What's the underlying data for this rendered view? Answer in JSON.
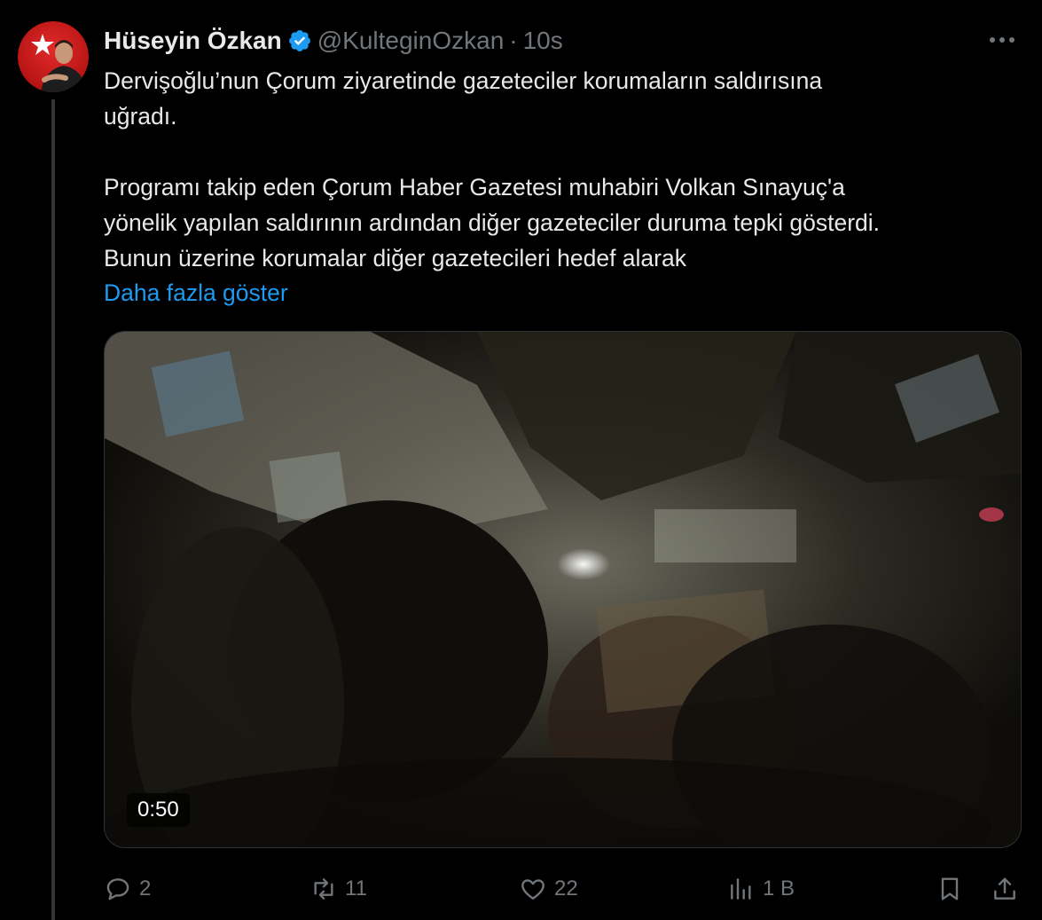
{
  "tweet": {
    "author_name": "Hüseyin Özkan",
    "handle": "@KulteginOzkan",
    "separator": "·",
    "time": "10s",
    "text_lines_1": [
      "Dervişoğlu’nun Çorum ziyaretinde gazeteciler korumaların saldırısına",
      "uğradı."
    ],
    "text_lines_2": [
      "Programı takip eden Çorum Haber Gazetesi muhabiri Volkan Sınayuç'a",
      "yönelik yapılan saldırının ardından diğer gazeteciler duruma tepki gösterdi.",
      "Bunun üzerine korumalar diğer gazetecileri hedef alarak"
    ],
    "show_more": "Daha fazla göster"
  },
  "media": {
    "video_duration": "0:50"
  },
  "actions": {
    "replies": "2",
    "retweets": "11",
    "likes": "22",
    "views": "1 B"
  },
  "colors": {
    "background": "#000000",
    "text": "#e7e9ea",
    "muted": "#71767b",
    "link": "#1d9bf0",
    "verified": "#1d9bf0"
  }
}
